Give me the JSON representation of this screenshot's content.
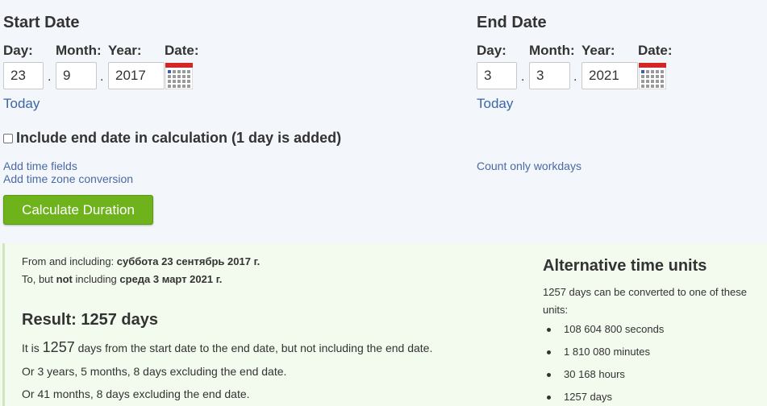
{
  "start": {
    "heading": "Start Date",
    "day_label": "Day:",
    "month_label": "Month:",
    "year_label": "Year:",
    "date_label": "Date:",
    "day": "23",
    "month": "9",
    "year": "2017",
    "today": "Today"
  },
  "end": {
    "heading": "End Date",
    "day_label": "Day:",
    "month_label": "Month:",
    "year_label": "Year:",
    "date_label": "Date:",
    "day": "3",
    "month": "3",
    "year": "2021",
    "today": "Today"
  },
  "separator": ".",
  "include_end_date": {
    "label": "Include end date in calculation (1 day is added)",
    "checked": false
  },
  "links": {
    "add_time_fields": "Add time fields",
    "add_time_zone": "Add time zone conversion",
    "count_workdays": "Count only workdays"
  },
  "calculate_button": "Calculate Duration",
  "result": {
    "from_prefix": "From and including: ",
    "from_date": "суббота 23 сентябрь 2017 г.",
    "to_prefix": "To, but ",
    "to_not": "not",
    "to_mid": " including ",
    "to_date": "среда 3 март 2021 г.",
    "title": "Result: 1257 days",
    "it_is": "It is ",
    "days_number": "1257",
    "days_suffix": " days from the start date to the end date, but not including the end date.",
    "or_years": "Or 3 years, 5 months, 8 days excluding the end date.",
    "or_months": "Or 41 months, 8 days excluding the end date."
  },
  "alternative": {
    "title": "Alternative time units",
    "description": "1257 days can be converted to one of these units:",
    "items": [
      "108 604 800 seconds",
      "1 810 080 minutes",
      "30 168 hours",
      "1257 days"
    ]
  },
  "colors": {
    "link": "#3a67a8",
    "button_green": "#6eb21c",
    "result_bg": "#f3faee",
    "calendar_red": "#d32626"
  }
}
